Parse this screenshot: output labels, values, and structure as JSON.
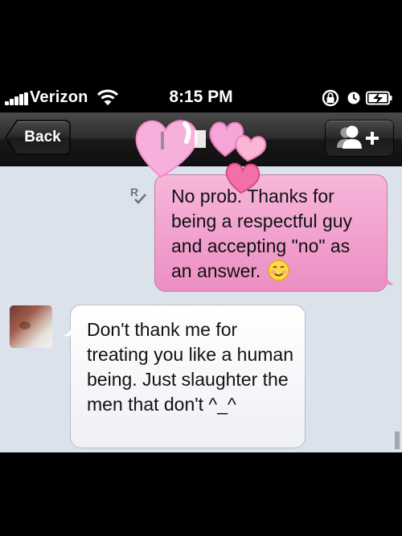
{
  "status_bar": {
    "carrier": "Verizon",
    "time": "8:15 PM",
    "icons": [
      "signal-bars-icon",
      "wifi-icon",
      "rotation-lock-icon",
      "alarm-clock-icon",
      "battery-charging-icon"
    ]
  },
  "nav": {
    "back_label": "Back",
    "add_contact_icon": "add-contact-icon"
  },
  "messages": [
    {
      "direction": "sent",
      "text": "No prob. Thanks for being a respectful guy and accepting \"no\" as an answer.",
      "emoji": "blushing-smiley-icon",
      "receipt": "read-receipt-icon"
    },
    {
      "direction": "received",
      "text": "Don't thank me for treating you like a human being. Just slaughter the men that don't ^_^"
    }
  ],
  "colors": {
    "sent_bubble": "#f0a0cf",
    "received_bubble": "#ffffff",
    "chat_background": "#dbe2ec",
    "heart_pink": "#f6a6d6"
  }
}
